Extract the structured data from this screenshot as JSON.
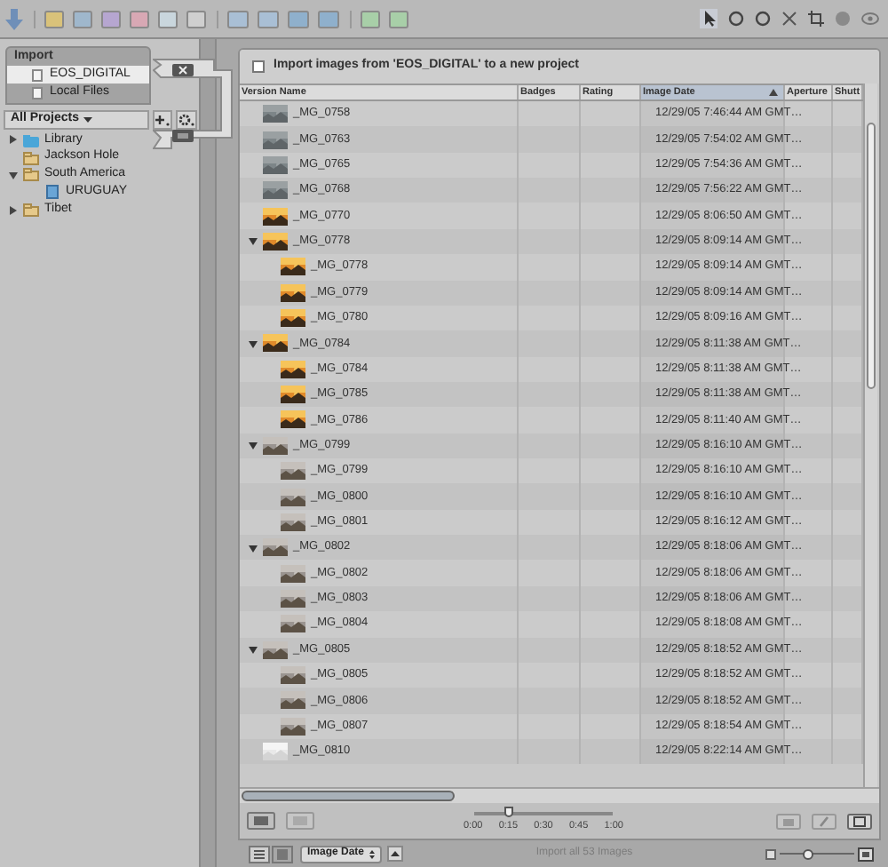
{
  "sidebar": {
    "import_header": "Import",
    "import_sources": [
      {
        "label": "EOS_DIGITAL",
        "selected": true
      },
      {
        "label": "Local Files",
        "selected": false
      }
    ],
    "projects_menu": "All Projects",
    "projects": [
      {
        "label": "Library",
        "kind": "library",
        "expanded": false
      },
      {
        "label": "Jackson Hole",
        "kind": "project"
      },
      {
        "label": "South America",
        "kind": "project",
        "expanded": true,
        "children": [
          {
            "label": "URUGUAY",
            "kind": "album"
          }
        ]
      },
      {
        "label": "Tibet",
        "kind": "project",
        "expanded": false
      }
    ]
  },
  "import_option": {
    "label": "Import images from 'EOS_DIGITAL' to a new project",
    "checked": false
  },
  "table": {
    "columns": [
      {
        "label": "Version Name",
        "selected": false
      },
      {
        "label": "Badges",
        "selected": false
      },
      {
        "label": "Rating",
        "selected": false
      },
      {
        "label": "Image Date",
        "selected": true
      },
      {
        "label": "Aperture",
        "selected": false
      },
      {
        "label": "Shutt",
        "selected": false
      }
    ],
    "rows": [
      {
        "kind": "single",
        "name": "_MG_0758",
        "date": "12/29/05 7:46:44 AM GMT…"
      },
      {
        "kind": "single",
        "name": "_MG_0763",
        "date": "12/29/05 7:54:02 AM GMT…"
      },
      {
        "kind": "single",
        "name": "_MG_0765",
        "date": "12/29/05 7:54:36 AM GMT…"
      },
      {
        "kind": "single",
        "name": "_MG_0768",
        "date": "12/29/05 7:56:22 AM GMT…"
      },
      {
        "kind": "single",
        "name": "_MG_0770",
        "date": "12/29/05 8:06:50 AM GMT…"
      },
      {
        "kind": "stack",
        "name": "_MG_0778",
        "date": "12/29/05 8:09:14 AM GMT…",
        "expanded": true,
        "children": [
          {
            "kind": "single",
            "name": "_MG_0778",
            "date": "12/29/05 8:09:14 AM GMT…"
          },
          {
            "kind": "single",
            "name": "_MG_0779",
            "date": "12/29/05 8:09:14 AM GMT…"
          },
          {
            "kind": "single",
            "name": "_MG_0780",
            "date": "12/29/05 8:09:16 AM GMT…"
          }
        ]
      },
      {
        "kind": "stack",
        "name": "_MG_0784",
        "date": "12/29/05 8:11:38 AM GMT…",
        "expanded": true,
        "children": [
          {
            "kind": "single",
            "name": "_MG_0784",
            "date": "12/29/05 8:11:38 AM GMT…"
          },
          {
            "kind": "single",
            "name": "_MG_0785",
            "date": "12/29/05 8:11:38 AM GMT…"
          },
          {
            "kind": "single",
            "name": "_MG_0786",
            "date": "12/29/05 8:11:40 AM GMT…"
          }
        ]
      },
      {
        "kind": "stack",
        "name": "_MG_0799",
        "date": "12/29/05 8:16:10 AM GMT…",
        "expanded": true,
        "children": [
          {
            "kind": "single",
            "name": "_MG_0799",
            "date": "12/29/05 8:16:10 AM GMT…"
          },
          {
            "kind": "single",
            "name": "_MG_0800",
            "date": "12/29/05 8:16:10 AM GMT…"
          },
          {
            "kind": "single",
            "name": "_MG_0801",
            "date": "12/29/05 8:16:12 AM GMT…"
          }
        ]
      },
      {
        "kind": "stack",
        "name": "_MG_0802",
        "date": "12/29/05 8:18:06 AM GMT…",
        "expanded": true,
        "children": [
          {
            "kind": "single",
            "name": "_MG_0802",
            "date": "12/29/05 8:18:06 AM GMT…"
          },
          {
            "kind": "single",
            "name": "_MG_0803",
            "date": "12/29/05 8:18:06 AM GMT…"
          },
          {
            "kind": "single",
            "name": "_MG_0804",
            "date": "12/29/05 8:18:08 AM GMT…"
          }
        ]
      },
      {
        "kind": "stack",
        "name": "_MG_0805",
        "date": "12/29/05 8:18:52 AM GMT…",
        "expanded": true,
        "children": [
          {
            "kind": "single",
            "name": "_MG_0805",
            "date": "12/29/05 8:18:52 AM GMT…"
          },
          {
            "kind": "single",
            "name": "_MG_0806",
            "date": "12/29/05 8:18:52 AM GMT…"
          },
          {
            "kind": "single",
            "name": "_MG_0807",
            "date": "12/29/05 8:18:54 AM GMT…"
          }
        ]
      },
      {
        "kind": "single",
        "name": "_MG_0810",
        "date": "12/29/05 8:22:14 AM GMT…"
      }
    ]
  },
  "timeline": {
    "level": 0.25,
    "ticks": [
      "0:00",
      "0:15",
      "0:30",
      "0:45",
      "1:00"
    ]
  },
  "footer": {
    "view_modes": [
      {
        "kind": "list",
        "selected": false
      },
      {
        "kind": "grid",
        "selected": true
      }
    ],
    "sort_menu": "Image Date",
    "import_button": {
      "label": "Import all 53 Images",
      "disabled": true
    },
    "thumbnail_size": {
      "level": 0.35
    }
  }
}
